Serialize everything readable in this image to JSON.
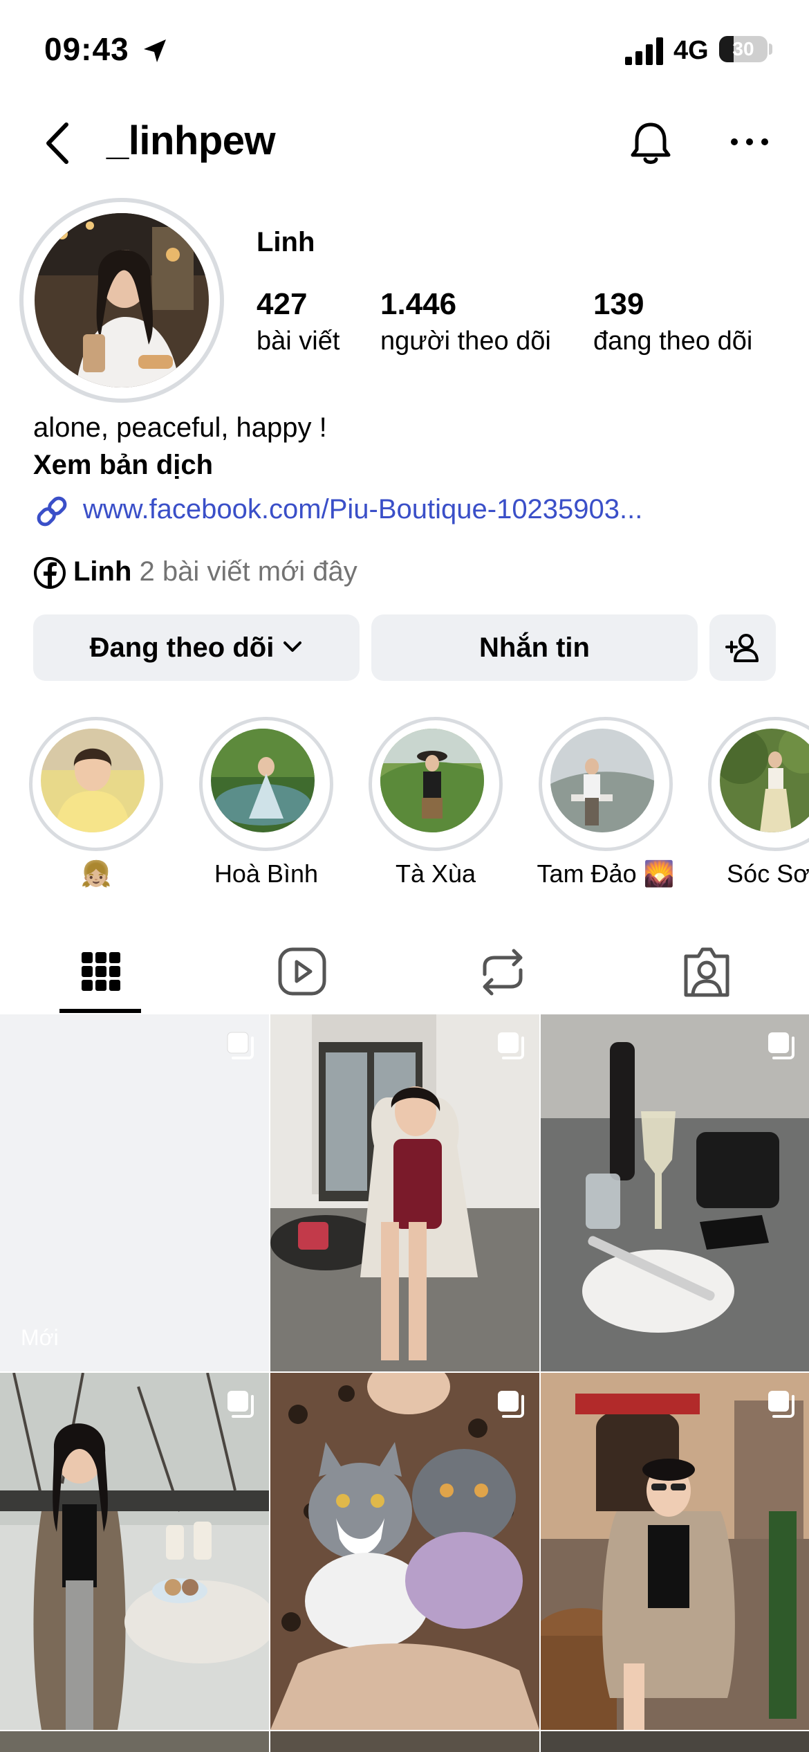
{
  "status_bar": {
    "time": "09:43",
    "network": "4G",
    "battery": "30",
    "battery_fraction": 0.3
  },
  "header": {
    "username": "_linhpew"
  },
  "profile": {
    "display_name": "Linh",
    "stats": [
      {
        "value": "427",
        "label": "bài viết"
      },
      {
        "value": "1.446",
        "label": "người theo dõi"
      },
      {
        "value": "139",
        "label": "đang theo dõi"
      }
    ],
    "bio": "alone, peaceful, happy !",
    "translate": "Xem bản dịch",
    "link": "www.facebook.com/Piu-Boutique-10235903...",
    "facebook": {
      "name": "Linh",
      "subtitle": "2 bài viết mới đây"
    }
  },
  "actions": {
    "following": "Đang theo dõi",
    "message": "Nhắn tin"
  },
  "highlights": [
    {
      "label": "👧🏼"
    },
    {
      "label": "Hoà Bình"
    },
    {
      "label": "Tà Xùa"
    },
    {
      "label": "Tam Đảo 🌄"
    },
    {
      "label": "Sóc Sơn"
    }
  ],
  "grid": {
    "new_label": "Mới"
  },
  "colors": {
    "link": "#3a4fc8",
    "button_bg": "#eef0f3",
    "ring": "#d9dce0",
    "muted": "#737373"
  }
}
